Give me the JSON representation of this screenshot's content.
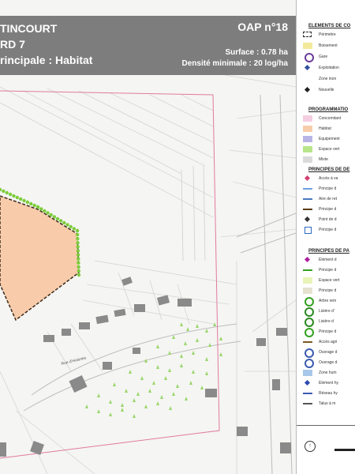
{
  "header": {
    "title_line1": "TINCOURT",
    "title_line2": "RD 7",
    "title_line3": "rincipale : Habitat",
    "oap_label": "OAP n°18",
    "surface": "Surface : 0.78 ha",
    "densite": "Densité minimale : 20 log/ha"
  },
  "map": {
    "street_label": "Rue d'Huisnes"
  },
  "legend": {
    "sections": [
      {
        "title": "ELEMENTS DE CO",
        "items": [
          {
            "label": "Périmètre",
            "icon": "dashed-box-icon"
          },
          {
            "label": "Boisement",
            "icon": "yellow-swatch-icon"
          },
          {
            "label": "Gare",
            "icon": "gare-icon"
          },
          {
            "label": "Exploitation",
            "icon": "star-icon"
          },
          {
            "label": "Zone inon",
            "icon": "none"
          },
          {
            "label": "Nouvelle",
            "icon": "small-star-icon"
          }
        ]
      },
      {
        "title": "PROGRAMMATIO",
        "items": [
          {
            "label": "Concomitant",
            "icon": "pink-swatch-icon"
          },
          {
            "label": "Habitat",
            "icon": "orange-swatch-icon"
          },
          {
            "label": "Equipement",
            "icon": "purple-swatch-icon"
          },
          {
            "label": "Espace vert",
            "icon": "green-swatch-icon"
          },
          {
            "label": "Mixte",
            "icon": "grey-swatch-icon"
          }
        ]
      },
      {
        "title": "PRINCIPES DE DE",
        "items": [
          {
            "label": "Accès à va",
            "icon": "pink-star-icon"
          },
          {
            "label": "Principe d",
            "icon": "blue-arrow-icon"
          },
          {
            "label": "Aire de ret",
            "icon": "blue-dash-icon"
          },
          {
            "label": "Principe d",
            "icon": "double-arrow-icon"
          },
          {
            "label": "Point de d",
            "icon": "point-icon"
          },
          {
            "label": "Principe d",
            "icon": "parking-icon"
          }
        ]
      },
      {
        "title": "PRINCIPES DE PA",
        "items": [
          {
            "label": "Élément d",
            "icon": "purple-asterisk-icon"
          },
          {
            "label": "Principe d",
            "icon": "green-chevron-icon"
          },
          {
            "label": "Espace vert",
            "icon": "lightgreen-swatch-icon"
          },
          {
            "label": "Principe d",
            "icon": "beige-swatch-icon"
          },
          {
            "label": "Arbre rem",
            "icon": "green-circle-icon"
          },
          {
            "label": "Lisière d'",
            "icon": "green-dots-icon"
          },
          {
            "label": "Lisière d",
            "icon": "green-rings-icon"
          },
          {
            "label": "Principe d",
            "icon": "green-bead-icon"
          },
          {
            "label": "Accès agri",
            "icon": "brown-arrow-icon"
          },
          {
            "label": "Ouvrage d",
            "icon": "blue-ring-icon"
          },
          {
            "label": "Ouvrage d",
            "icon": "blue-ring2-icon"
          },
          {
            "label": "Zone hum",
            "icon": "blue-swatch-icon"
          },
          {
            "label": "Élément hy",
            "icon": "blue-triangle-icon"
          },
          {
            "label": "Réseau hy",
            "icon": "blue-line-icon"
          },
          {
            "label": "Talus à m",
            "icon": "dotted-line-icon"
          }
        ]
      }
    ]
  },
  "colors": {
    "header_bg": "#7d7d7d",
    "habitat_fill": "#f8ccaa",
    "perimeter": "#e07aa0",
    "hedge": "#7ccc3c",
    "building": "#8a8a8a"
  }
}
